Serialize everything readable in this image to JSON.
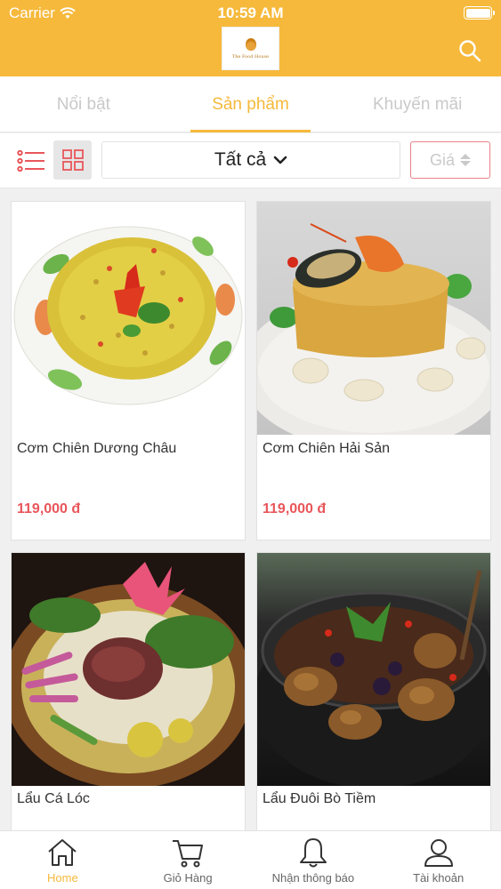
{
  "status_bar": {
    "carrier": "Carrier",
    "time": "10:59 AM"
  },
  "header": {
    "logo_text": "The Food House",
    "accent_color": "#f6b93b",
    "search_icon": "search-icon"
  },
  "tabs": [
    {
      "label": "Nổi bật",
      "active": false
    },
    {
      "label": "Sản phẩm",
      "active": true
    },
    {
      "label": "Khuyến mãi",
      "active": false
    }
  ],
  "filter": {
    "list_view_icon": "list-view-icon",
    "grid_view_icon": "grid-view-icon",
    "grid_view_active": true,
    "category": "Tất cả",
    "price_sort_label": "Giá"
  },
  "products": [
    {
      "name": "Cơm Chiên Dương Châu",
      "price": "119,000 đ"
    },
    {
      "name": "Cơm Chiên Hải Sản",
      "price": "119,000 đ"
    },
    {
      "name": "Lẩu Cá Lóc",
      "price": ""
    },
    {
      "name": "Lẩu Đuôi Bò Tiềm",
      "price": ""
    }
  ],
  "bottom_nav": [
    {
      "label": "Home",
      "icon": "home-icon",
      "active": true
    },
    {
      "label": "Giỏ Hàng",
      "icon": "cart-icon",
      "active": false
    },
    {
      "label": "Nhận thông báo",
      "icon": "bell-icon",
      "active": false
    },
    {
      "label": "Tài khoản",
      "icon": "user-icon",
      "active": false
    }
  ],
  "colors": {
    "accent": "#f6b93b",
    "price": "#e8565b",
    "inactive_tab": "#c9c9c9"
  }
}
